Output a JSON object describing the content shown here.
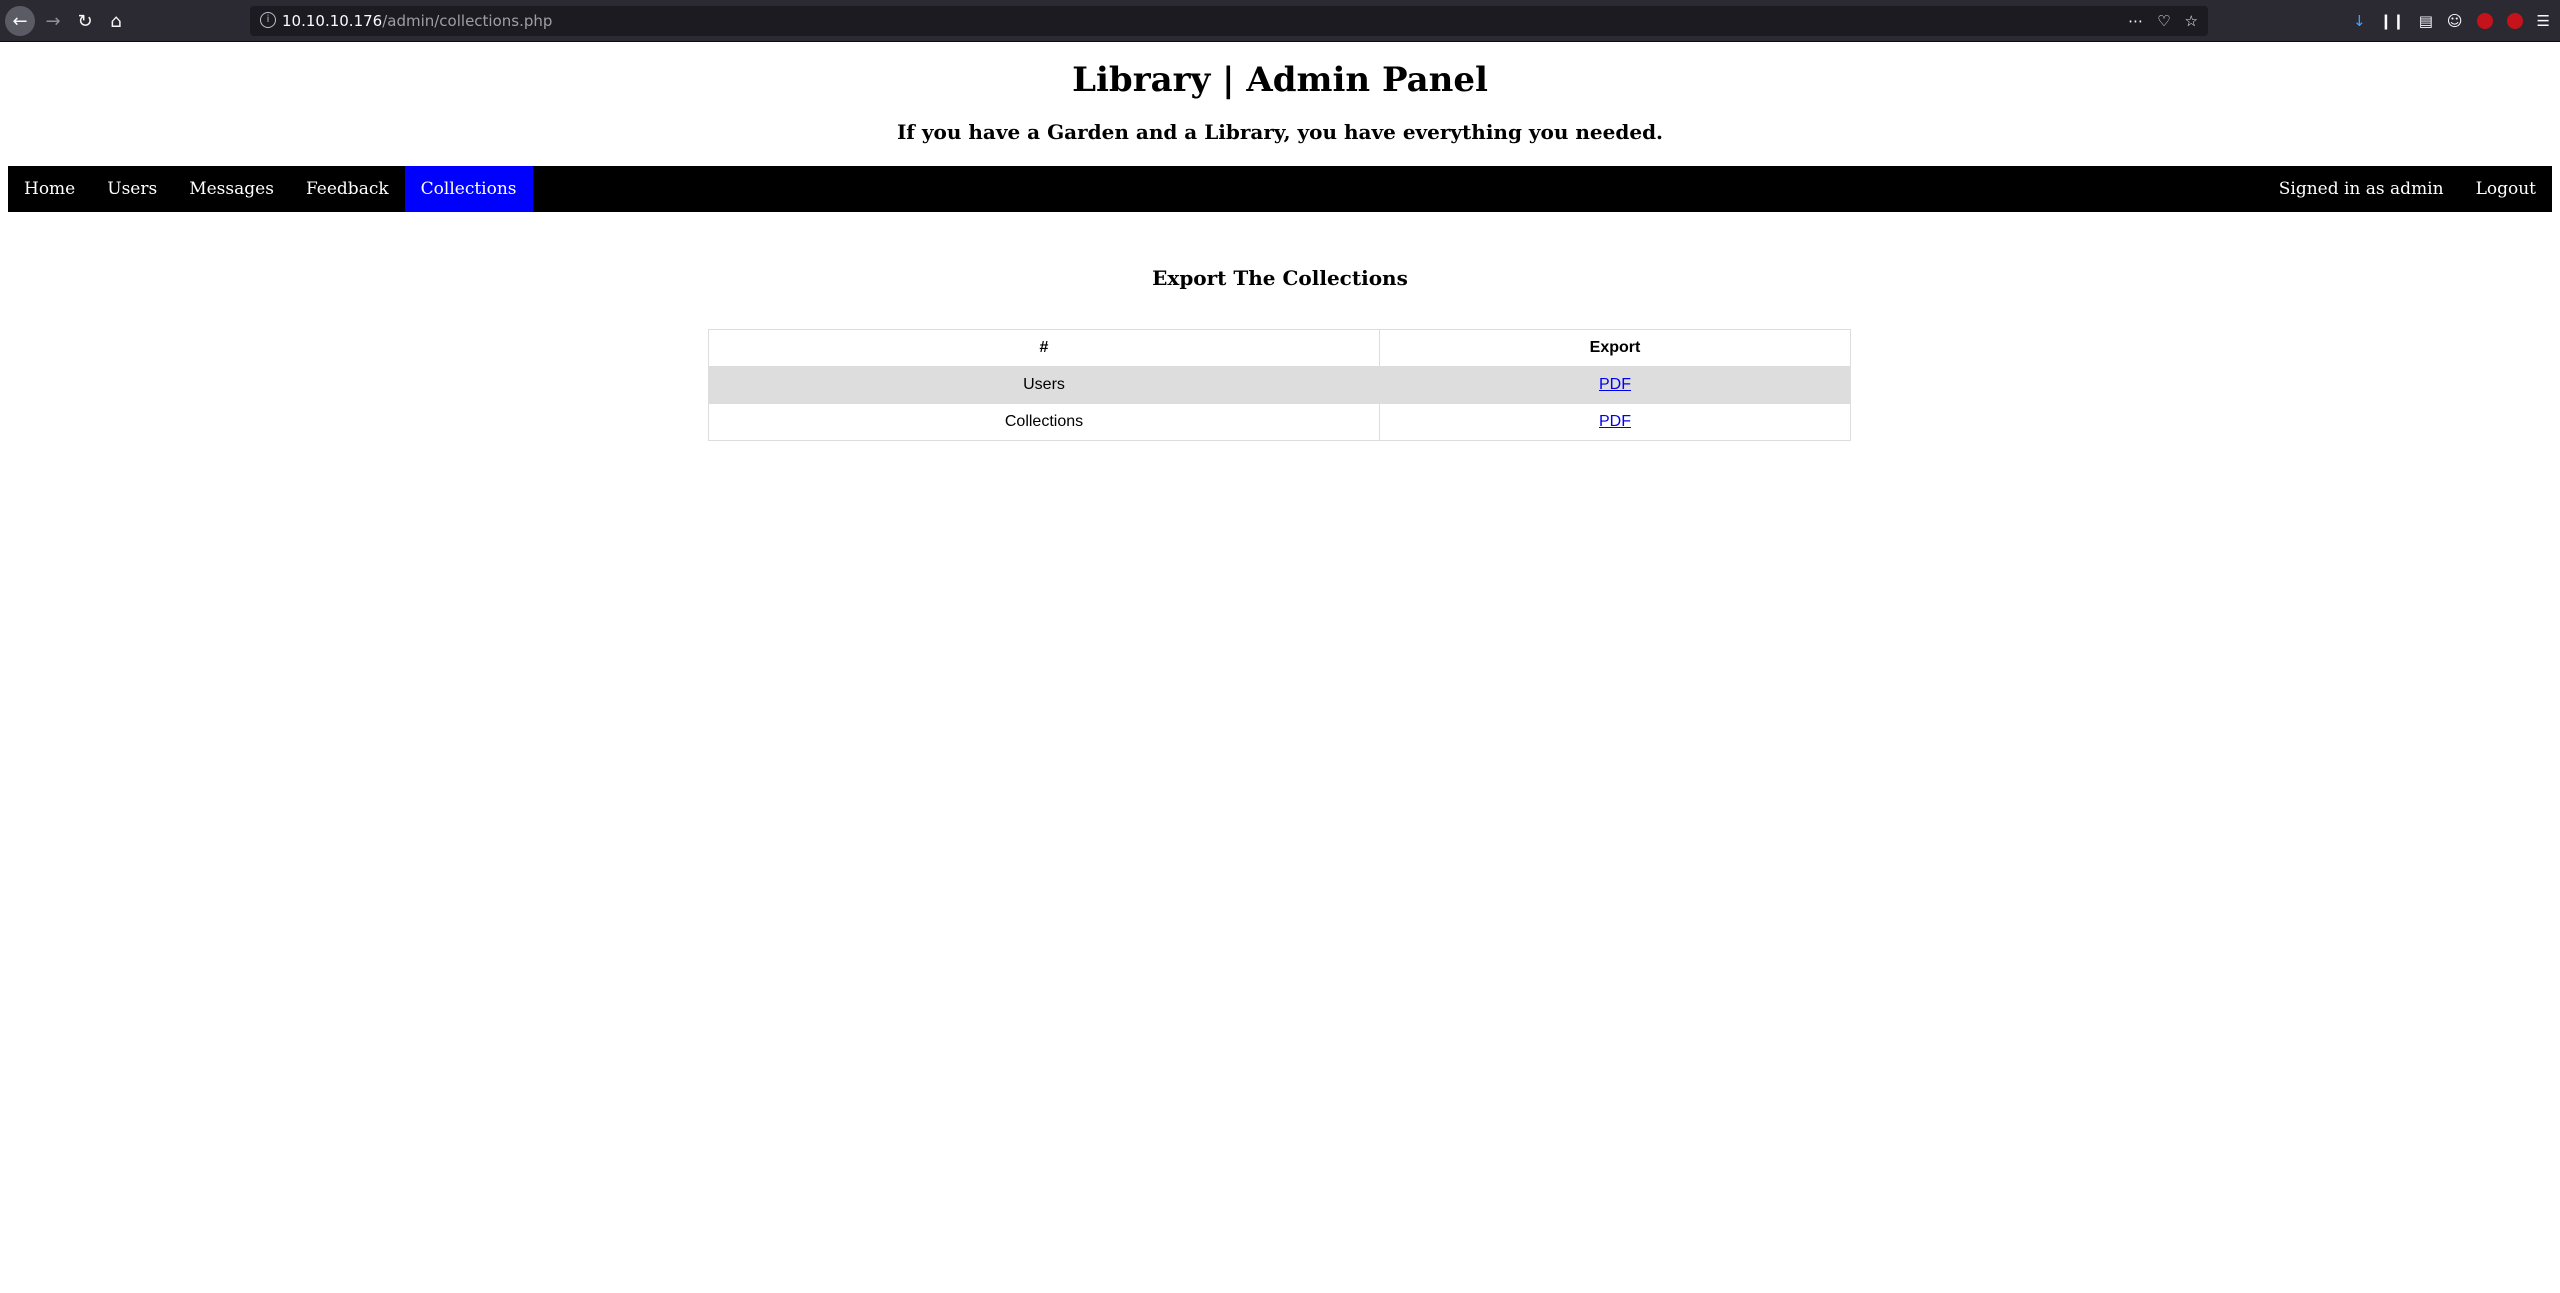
{
  "browser": {
    "url_host": "10.10.10.176",
    "url_path": "/admin/collections.php"
  },
  "header": {
    "title": "Library | Admin Panel",
    "subtitle": "If you have a Garden and a Library, you have everything you needed."
  },
  "nav": {
    "items": [
      {
        "label": "Home"
      },
      {
        "label": "Users"
      },
      {
        "label": "Messages"
      },
      {
        "label": "Feedback"
      },
      {
        "label": "Collections"
      }
    ],
    "signed_in": "Signed in as admin",
    "logout": "Logout"
  },
  "main": {
    "title": "Export The Collections",
    "table": {
      "headers": [
        "#",
        "Export"
      ],
      "rows": [
        {
          "name": "Users",
          "export": "PDF"
        },
        {
          "name": "Collections",
          "export": "PDF"
        }
      ]
    }
  },
  "colors": {
    "nav_bg": "#000000",
    "nav_active": "#0000ff",
    "row_alt": "#dddddd",
    "link": "#0000ee"
  }
}
